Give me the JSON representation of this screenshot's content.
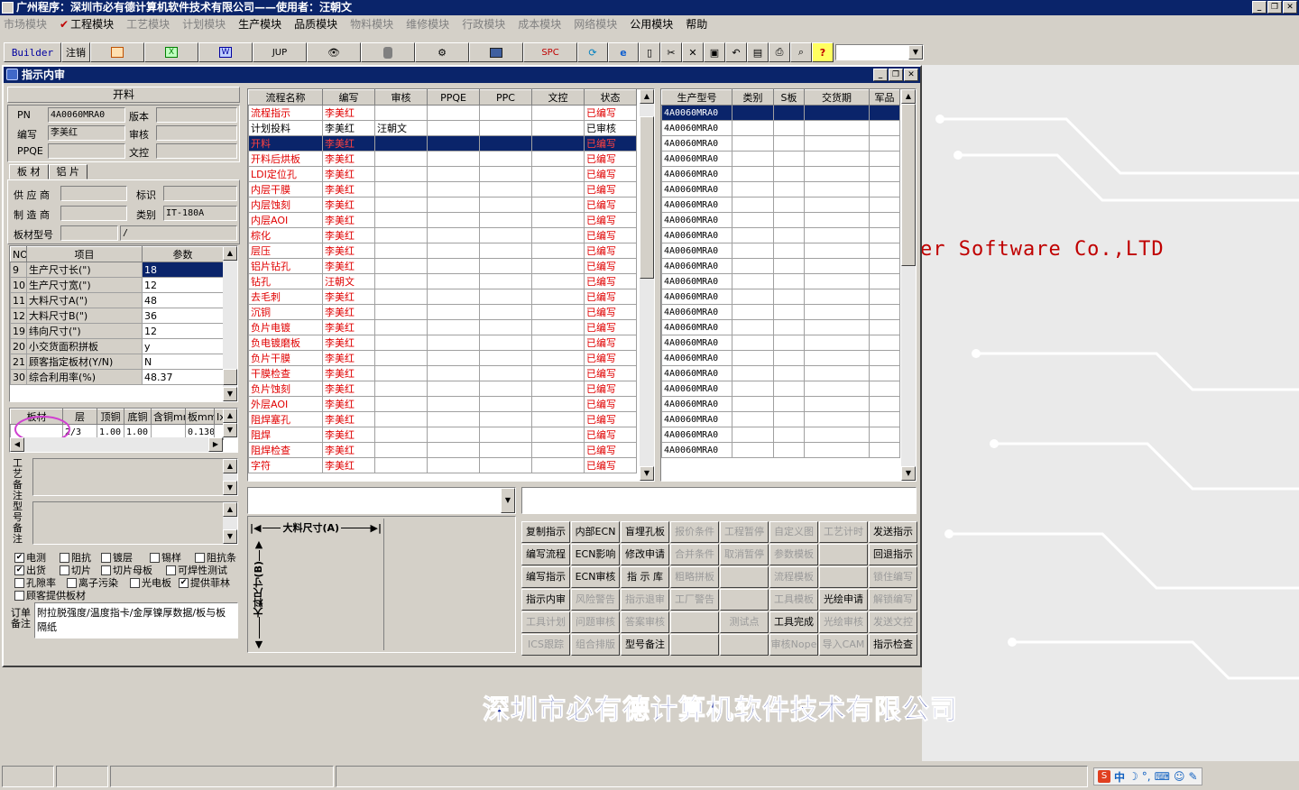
{
  "app": {
    "title": "广州程序：深圳市必有德计算机软件技术有限公司——使用者：汪朝文"
  },
  "menu": [
    {
      "label": "市场模块",
      "enabled": false
    },
    {
      "label": "工程模块",
      "enabled": true,
      "checked": true
    },
    {
      "label": "工艺模块",
      "enabled": false
    },
    {
      "label": "计划模块",
      "enabled": false
    },
    {
      "label": "生产模块",
      "enabled": true
    },
    {
      "label": "品质模块",
      "enabled": true
    },
    {
      "label": "物料模块",
      "enabled": false
    },
    {
      "label": "维修模块",
      "enabled": false
    },
    {
      "label": "行政模块",
      "enabled": false
    },
    {
      "label": "成本模块",
      "enabled": false
    },
    {
      "label": "网络模块",
      "enabled": false
    },
    {
      "label": "公用模块",
      "enabled": true
    },
    {
      "label": "帮助",
      "enabled": true
    }
  ],
  "toolbar": {
    "builder": "Builder",
    "logout": "注销",
    "jup": "JUP",
    "spc": "SPC",
    "icons": [
      "powerpoint-icon",
      "excel-icon",
      "word-icon",
      "jup-icon",
      "eye-icon",
      "database-icon",
      "network-icon",
      "computer-icon",
      "spc-icon",
      "refresh-icon",
      "ie-icon",
      "new-icon",
      "cut-icon",
      "delete-icon",
      "save-icon",
      "undo-icon",
      "preview-icon",
      "print-icon",
      "find-icon",
      "help-icon"
    ]
  },
  "window": {
    "title": "指示内审"
  },
  "left": {
    "section_title": "开料",
    "pn_label": "PN",
    "pn_value": "4A0060MRA0",
    "version_label": "版本",
    "version_value": "",
    "author_label": "编写",
    "author_value": "李美红",
    "review_label": "审核",
    "review_value": "",
    "ppqe_label": "PPQE",
    "ppqe_value": "",
    "wenkong_label": "文控",
    "wenkong_value": "",
    "tabs": [
      "板 材",
      "铝 片"
    ],
    "supplier_label": "供 应 商",
    "supplier_value": "",
    "mark_label": "标识",
    "mark_value": "",
    "maker_label": "制 造 商",
    "maker_value": "",
    "type_label": "类别",
    "type_value": "IT-180A",
    "model_label": "板材型号",
    "model_value": "",
    "model_value2": "/",
    "param_headers": [
      "NO",
      "项目",
      "参数"
    ],
    "params": [
      {
        "no": "9",
        "item": "生产尺寸长(\")",
        "value": "18",
        "selected": true
      },
      {
        "no": "10",
        "item": "生产尺寸宽(\")",
        "value": "12"
      },
      {
        "no": "11",
        "item": "大料尺寸A(\")",
        "value": "48"
      },
      {
        "no": "12",
        "item": "大料尺寸B(\")",
        "value": "36"
      },
      {
        "no": "19",
        "item": "纬向尺寸(\")",
        "value": "12"
      },
      {
        "no": "20",
        "item": "小交货面积拼板",
        "value": "y"
      },
      {
        "no": "21",
        "item": "顾客指定板材(Y/N)",
        "value": "N"
      },
      {
        "no": "30",
        "item": "综合利用率(%)",
        "value": "48.37"
      }
    ],
    "layer_headers": [
      "板材",
      "层",
      "顶铜",
      "底铜",
      "含铜mm",
      "板mm",
      "Ix"
    ],
    "layer_row": [
      "",
      "2/3",
      "1.00",
      "1.00",
      "",
      "0.130",
      ""
    ],
    "process_note_label": "工艺备注",
    "model_note_label": "型号备注",
    "checks": [
      {
        "label": "电测",
        "checked": true
      },
      {
        "label": "阻抗",
        "checked": false
      },
      {
        "label": "镀层",
        "checked": false
      },
      {
        "label": "锡样",
        "checked": false
      },
      {
        "label": "阻抗条",
        "checked": false
      },
      {
        "label": "出货",
        "checked": true
      },
      {
        "label": "切片",
        "checked": false
      },
      {
        "label": "切片母板",
        "checked": false
      },
      {
        "label": "可焊性测试",
        "checked": false
      },
      {
        "label": "孔隙率",
        "checked": false
      },
      {
        "label": "离子污染",
        "checked": false
      },
      {
        "label": "光电板",
        "checked": false
      },
      {
        "label": "提供菲林",
        "checked": true
      },
      {
        "label": "顾客提供板材",
        "checked": false
      }
    ],
    "order_note_label": "订单备注",
    "order_note": "附拉脱强度/温度指卡/金厚镍厚数据/板与板隔纸"
  },
  "flow": {
    "headers": [
      "流程名称",
      "编写",
      "审核",
      "PPQE",
      "PPC",
      "文控",
      "状态"
    ],
    "rows": [
      {
        "name": "流程指示",
        "author": "李美红",
        "reviewer": "",
        "status": "已编写",
        "red": true
      },
      {
        "name": "计划投料",
        "author": "李美红",
        "reviewer": "汪朝文",
        "status": "已审核",
        "red": false
      },
      {
        "name": "开料",
        "author": "李美红",
        "reviewer": "",
        "status": "已编写",
        "red": true,
        "selected": true
      },
      {
        "name": "开料后烘板",
        "author": "李美红",
        "reviewer": "",
        "status": "已编写",
        "red": true
      },
      {
        "name": "LDI定位孔",
        "author": "李美红",
        "reviewer": "",
        "status": "已编写",
        "red": true
      },
      {
        "name": "内层干膜",
        "author": "李美红",
        "reviewer": "",
        "status": "已编写",
        "red": true
      },
      {
        "name": "内层蚀刻",
        "author": "李美红",
        "reviewer": "",
        "status": "已编写",
        "red": true
      },
      {
        "name": "内层AOI",
        "author": "李美红",
        "reviewer": "",
        "status": "已编写",
        "red": true
      },
      {
        "name": "棕化",
        "author": "李美红",
        "reviewer": "",
        "status": "已编写",
        "red": true
      },
      {
        "name": "层压",
        "author": "李美红",
        "reviewer": "",
        "status": "已编写",
        "red": true
      },
      {
        "name": "铝片钻孔",
        "author": "李美红",
        "reviewer": "",
        "status": "已编写",
        "red": true
      },
      {
        "name": "钻孔",
        "author": "汪朝文",
        "reviewer": "",
        "status": "已编写",
        "red": true
      },
      {
        "name": "去毛刺",
        "author": "李美红",
        "reviewer": "",
        "status": "已编写",
        "red": true
      },
      {
        "name": "沉铜",
        "author": "李美红",
        "reviewer": "",
        "status": "已编写",
        "red": true
      },
      {
        "name": "负片电镀",
        "author": "李美红",
        "reviewer": "",
        "status": "已编写",
        "red": true
      },
      {
        "name": "负电镀磨板",
        "author": "李美红",
        "reviewer": "",
        "status": "已编写",
        "red": true
      },
      {
        "name": "负片干膜",
        "author": "李美红",
        "reviewer": "",
        "status": "已编写",
        "red": true
      },
      {
        "name": "干膜检查",
        "author": "李美红",
        "reviewer": "",
        "status": "已编写",
        "red": true
      },
      {
        "name": "负片蚀刻",
        "author": "李美红",
        "reviewer": "",
        "status": "已编写",
        "red": true
      },
      {
        "name": "外层AOI",
        "author": "李美红",
        "reviewer": "",
        "status": "已编写",
        "red": true
      },
      {
        "name": "阻焊塞孔",
        "author": "李美红",
        "reviewer": "",
        "status": "已编写",
        "red": true
      },
      {
        "name": "阻焊",
        "author": "李美红",
        "reviewer": "",
        "status": "已编写",
        "red": true
      },
      {
        "name": "阻焊检查",
        "author": "李美红",
        "reviewer": "",
        "status": "已编写",
        "red": true
      },
      {
        "name": "字符",
        "author": "李美红",
        "reviewer": "",
        "status": "已编写",
        "red": true
      }
    ]
  },
  "models": {
    "headers": [
      "生产型号",
      "类别",
      "S板",
      "交货期",
      "军品"
    ],
    "rows": [
      "4A0060MRA0",
      "4A0060MRA0",
      "4A0060MRA0",
      "4A0060MRA0",
      "4A0060MRA0",
      "4A0060MRA0",
      "4A0060MRA0",
      "4A0060MRA0",
      "4A0060MRA0",
      "4A0060MRA0",
      "4A0060MRA0",
      "4A0060MRA0",
      "4A0060MRA0",
      "4A0060MRA0",
      "4A0060MRA0",
      "4A0060MRA0",
      "4A0060MRA0",
      "4A0060MRA0",
      "4A0060MRA0",
      "4A0060MRA0",
      "4A0060MRA0",
      "4A0060MRA0",
      "4A0060MRA0"
    ]
  },
  "dims": {
    "a_label": "大料尺寸(A)",
    "b_label": "大料尺寸(B)"
  },
  "buttons": [
    [
      "复制指示",
      "内部ECN",
      "盲埋孔板",
      "报价条件",
      "工程暂停",
      "自定义图",
      "工艺计时",
      "发送指示"
    ],
    [
      "编写流程",
      "ECN影响",
      "修改申请",
      "合并条件",
      "取消暂停",
      "参数模板",
      "",
      "回退指示"
    ],
    [
      "编写指示",
      "ECN审核",
      "指 示 库",
      "粗略拼板",
      "",
      "流程模板",
      "",
      "锁住编写"
    ],
    [
      "指示内审",
      "风险警告",
      "指示退审",
      "工厂警告",
      "",
      "工具模板",
      "光绘申请",
      "解锁编写"
    ],
    [
      "工具计划",
      "问题审核",
      "答案审核",
      "",
      "测试点",
      "工具完成",
      "光绘审核",
      "发送文控"
    ],
    [
      "ICS跟踪",
      "组合排版",
      "型号备注",
      "",
      "",
      "审核Nope",
      "导入CAM",
      "指示检查"
    ]
  ],
  "button_enabled": [
    [
      true,
      true,
      true,
      false,
      false,
      false,
      false,
      true
    ],
    [
      true,
      true,
      true,
      false,
      false,
      false,
      false,
      true
    ],
    [
      true,
      true,
      true,
      false,
      false,
      false,
      false,
      false
    ],
    [
      true,
      false,
      false,
      false,
      false,
      false,
      true,
      false
    ],
    [
      false,
      false,
      false,
      false,
      false,
      true,
      false,
      false
    ],
    [
      false,
      false,
      true,
      false,
      false,
      false,
      false,
      true
    ]
  ],
  "brand": {
    "en": "er Software Co.,LTD",
    "cn": "深圳市必有德计算机软件技术有限公司"
  },
  "tray": {
    "ime": "中"
  }
}
